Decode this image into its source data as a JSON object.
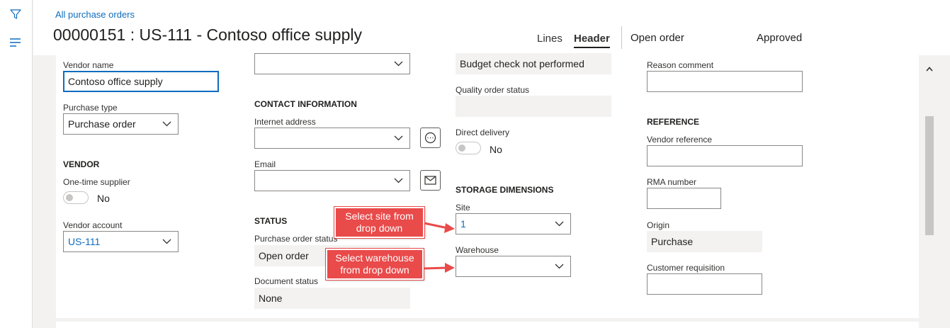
{
  "header": {
    "breadcrumb": "All purchase orders",
    "title": "00000151 : US-111 - Contoso office supply",
    "tabs": [
      "Lines",
      "Header"
    ],
    "active_tab": "Header",
    "status_1": "Open order",
    "status_2": "Approved"
  },
  "col1": {
    "vendor_name_label": "Vendor name",
    "vendor_name_value": "Contoso office supply",
    "purchase_type_label": "Purchase type",
    "purchase_type_value": "Purchase order",
    "vendor_section": "VENDOR",
    "one_time_label": "One-time supplier",
    "one_time_value": "No",
    "vendor_account_label": "Vendor account",
    "vendor_account_value": "US-111"
  },
  "col2": {
    "top_dropdown_value": "",
    "contact_section": "CONTACT INFORMATION",
    "internet_label": "Internet address",
    "internet_value": "",
    "email_label": "Email",
    "email_value": "",
    "status_section": "STATUS",
    "po_status_label": "Purchase order status",
    "po_status_value": "Open order",
    "doc_status_label": "Document status",
    "doc_status_value": "None"
  },
  "col3": {
    "budget_value": "Budget check not performed",
    "quality_label": "Quality order status",
    "quality_value": "",
    "direct_label": "Direct delivery",
    "direct_value": "No",
    "storage_section": "STORAGE DIMENSIONS",
    "site_label": "Site",
    "site_value": "1",
    "warehouse_label": "Warehouse",
    "warehouse_value": ""
  },
  "col4": {
    "reason_label": "Reason comment",
    "reason_value": "",
    "reference_section": "REFERENCE",
    "vendor_ref_label": "Vendor reference",
    "vendor_ref_value": "",
    "rma_label": "RMA number",
    "rma_value": "",
    "origin_label": "Origin",
    "origin_value": "Purchase",
    "customer_req_label": "Customer requisition",
    "customer_req_value": ""
  },
  "callouts": {
    "site": "Select site from drop down",
    "warehouse": "Select warehouse from drop down"
  },
  "colors": {
    "accent": "#0f6cbd",
    "callout": "#e94a4a"
  },
  "icons": [
    "filter-icon",
    "list-icon",
    "chevron-down-icon",
    "globe-icon",
    "mail-icon",
    "chevron-up-icon"
  ]
}
